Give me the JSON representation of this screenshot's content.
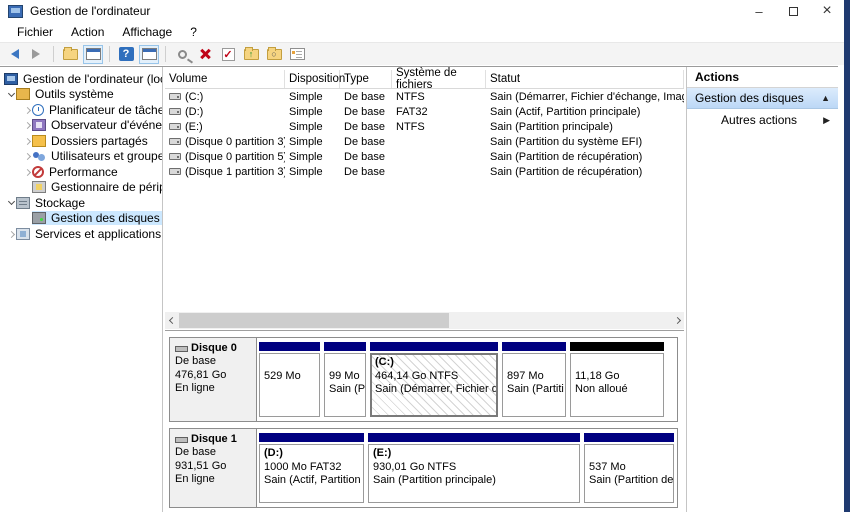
{
  "titlebar": {
    "title": "Gestion de l'ordinateur",
    "minimize": "–",
    "close": "×"
  },
  "menu": {
    "items": [
      "Fichier",
      "Action",
      "Affichage",
      "?"
    ]
  },
  "toolbar": {
    "icons": [
      "back",
      "forward",
      "export-list",
      "show-console-tree",
      "help",
      "show-action-pane",
      "pointer-help",
      "delete",
      "mark-active",
      "folder-up",
      "explore",
      "properties"
    ]
  },
  "tree": {
    "items": [
      {
        "label": "Gestion de l'ordinateur (local)",
        "icon": "computer"
      },
      {
        "label": "Outils système",
        "icon": "system-tools",
        "expanded": true
      },
      {
        "label": "Planificateur de tâches",
        "icon": "task-scheduler",
        "expanded": false
      },
      {
        "label": "Observateur d'événeme",
        "icon": "event-viewer",
        "expanded": false
      },
      {
        "label": "Dossiers partagés",
        "icon": "shared-folders",
        "expanded": false
      },
      {
        "label": "Utilisateurs et groupes l",
        "icon": "local-users-groups",
        "expanded": false
      },
      {
        "label": "Performance",
        "icon": "performance",
        "expanded": false
      },
      {
        "label": "Gestionnaire de périphé",
        "icon": "device-manager"
      },
      {
        "label": "Stockage",
        "icon": "storage",
        "expanded": true
      },
      {
        "label": "Gestion des disques",
        "icon": "disk-management",
        "selected": true
      },
      {
        "label": "Services et applications",
        "icon": "services-apps",
        "expanded": false
      }
    ]
  },
  "volume_table": {
    "columns": [
      "Volume",
      "Disposition",
      "Type",
      "Système de fichiers",
      "Statut"
    ],
    "rows": [
      [
        "(C:)",
        "Simple",
        "De base",
        "NTFS",
        "Sain (Démarrer, Fichier d'échange, Image"
      ],
      [
        "(D:)",
        "Simple",
        "De base",
        "FAT32",
        "Sain (Actif, Partition principale)"
      ],
      [
        "(E:)",
        "Simple",
        "De base",
        "NTFS",
        "Sain (Partition principale)"
      ],
      [
        "(Disque 0 partition 3)",
        "Simple",
        "De base",
        "",
        "Sain (Partition du système EFI)"
      ],
      [
        "(Disque 0 partition 5)",
        "Simple",
        "De base",
        "",
        "Sain (Partition de récupération)"
      ],
      [
        "(Disque 1 partition 3)",
        "Simple",
        "De base",
        "",
        "Sain (Partition de récupération)"
      ]
    ]
  },
  "actions_panel": {
    "title": "Actions",
    "group_title": "Gestion des disques",
    "collapse_icon": "▲",
    "item_label": "Autres actions",
    "submenu_icon": "▶"
  },
  "disk_view": {
    "disks": [
      {
        "name": "Disque 0",
        "type": "De base",
        "size": "476,81 Go",
        "status": "En ligne",
        "partitions": [
          {
            "lines": [
              "",
              "529 Mo",
              ""
            ]
          },
          {
            "lines": [
              "",
              "99 Mo",
              "Sain (P"
            ]
          },
          {
            "lines": [
              "(C:)",
              "464,14 Go NTFS",
              "Sain (Démarrer, Fichier d'é"
            ]
          },
          {
            "lines": [
              "",
              "897 Mo",
              "Sain (Partiti"
            ]
          },
          {
            "lines": [
              "",
              "11,18 Go",
              "Non alloué"
            ]
          }
        ]
      },
      {
        "name": "Disque 1",
        "type": "De base",
        "size": "931,51 Go",
        "status": "En ligne",
        "partitions": [
          {
            "lines": [
              "(D:)",
              "1000 Mo FAT32",
              "Sain (Actif, Partition"
            ]
          },
          {
            "lines": [
              "(E:)",
              "930,01 Go NTFS",
              "Sain (Partition principale)"
            ]
          },
          {
            "lines": [
              "",
              "537 Mo",
              "Sain (Partition de r"
            ]
          }
        ]
      }
    ]
  },
  "colors": {
    "partition_bar": "#000080",
    "unallocated_bar": "#000000",
    "tree_selection": "#cce8ff",
    "window_border": "#1f3a70"
  }
}
